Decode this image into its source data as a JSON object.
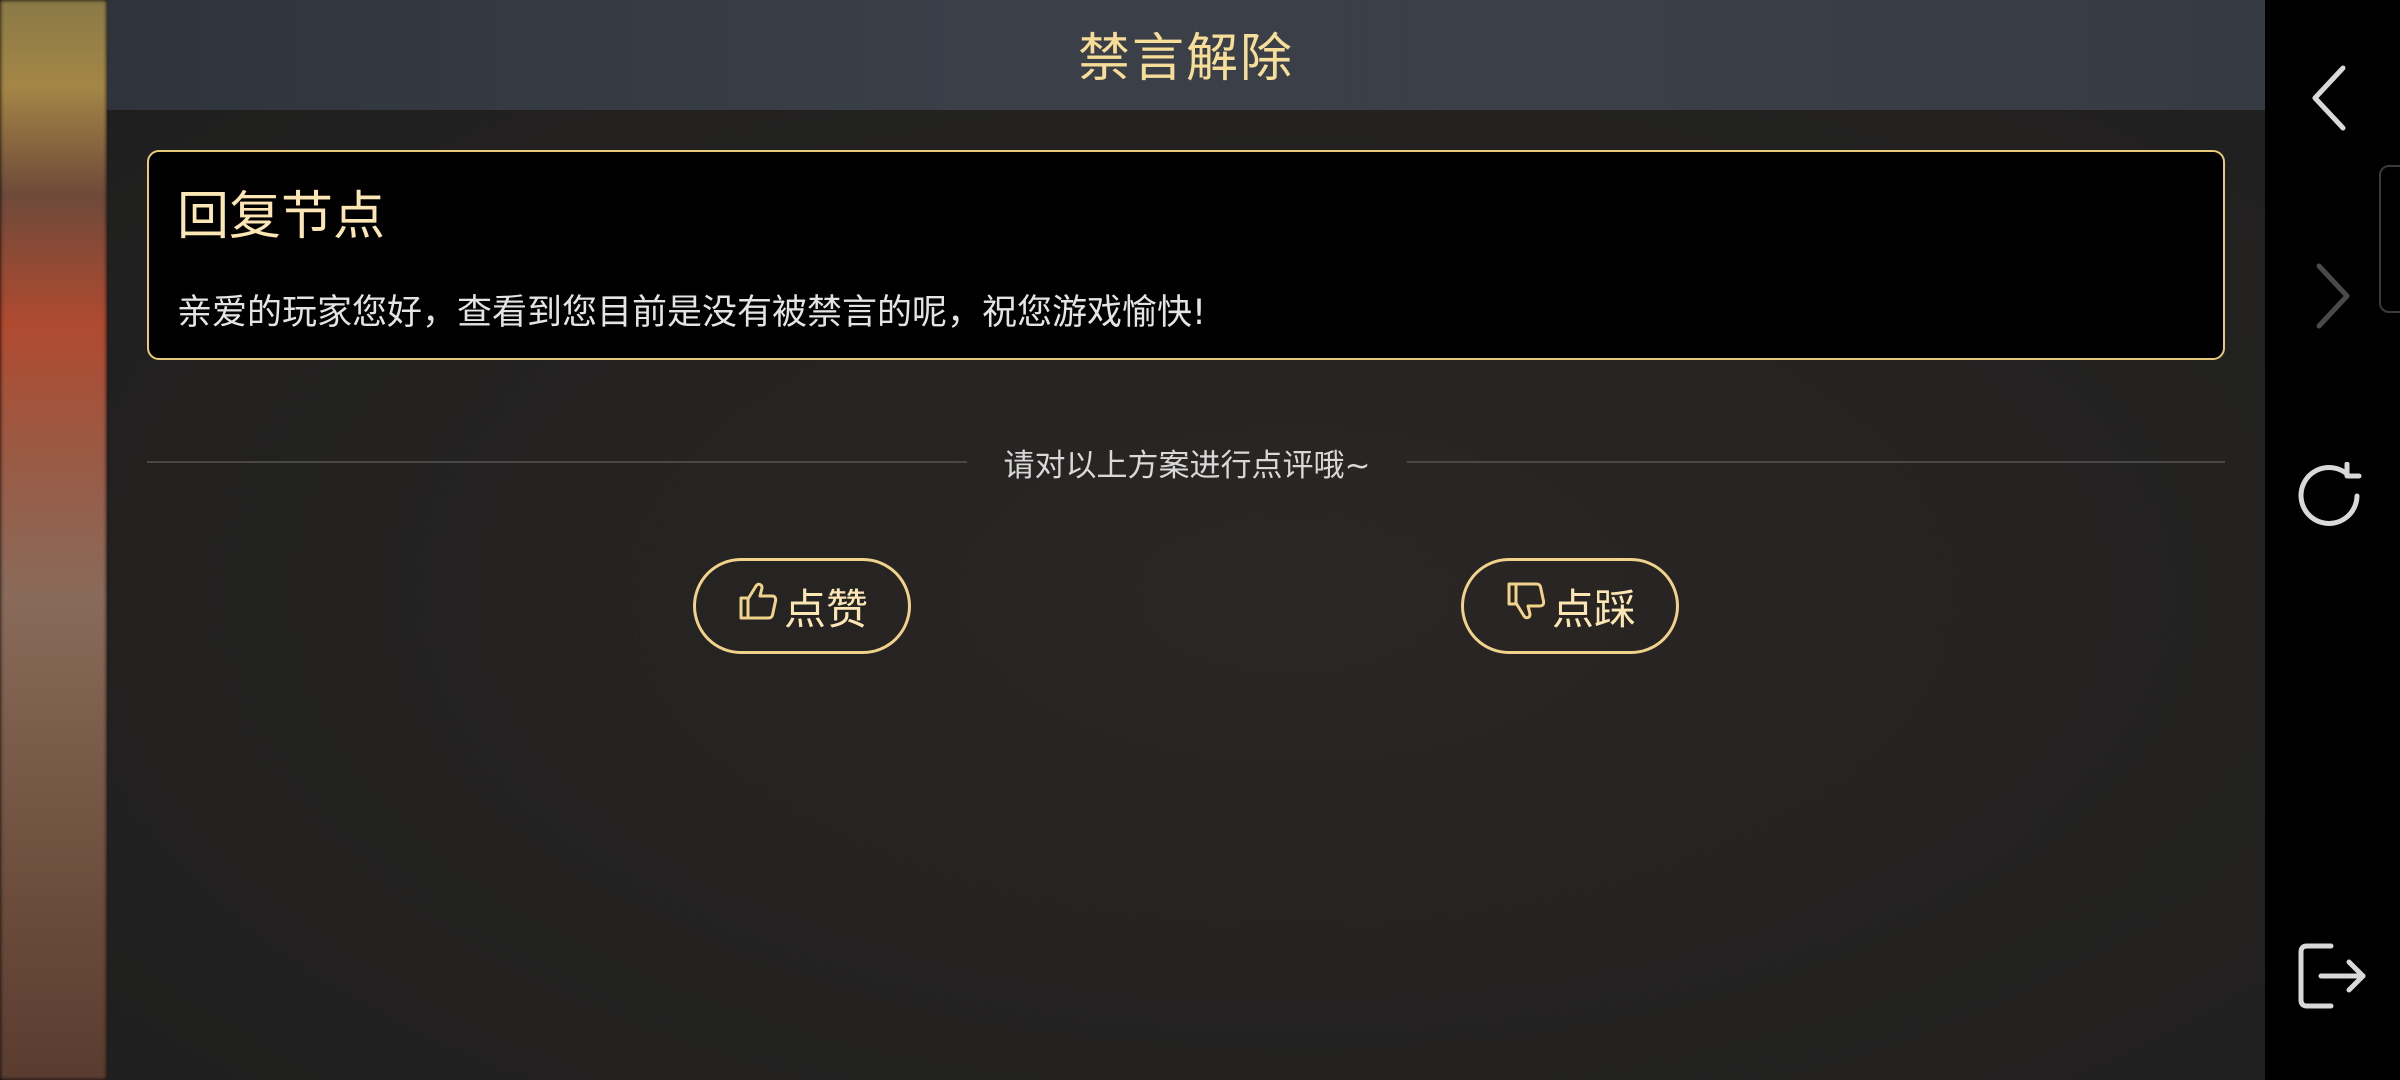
{
  "header": {
    "title": "禁言解除"
  },
  "reply": {
    "title": "回复节点",
    "body": "亲爱的玩家您好，查看到您目前是没有被禁言的呢，祝您游戏愉快!"
  },
  "rating": {
    "prompt": "请对以上方案进行点评哦~",
    "like_label": "点赞",
    "dislike_label": "点踩"
  },
  "sidebar": {
    "icons": [
      "back-icon",
      "forward-icon",
      "refresh-icon",
      "exit-icon"
    ]
  },
  "colors": {
    "accent": "#f0d28a",
    "title_text": "#f6dd98",
    "card_bg": "#000000",
    "panel_bg": "#242322",
    "header_bg": "#393d46"
  }
}
